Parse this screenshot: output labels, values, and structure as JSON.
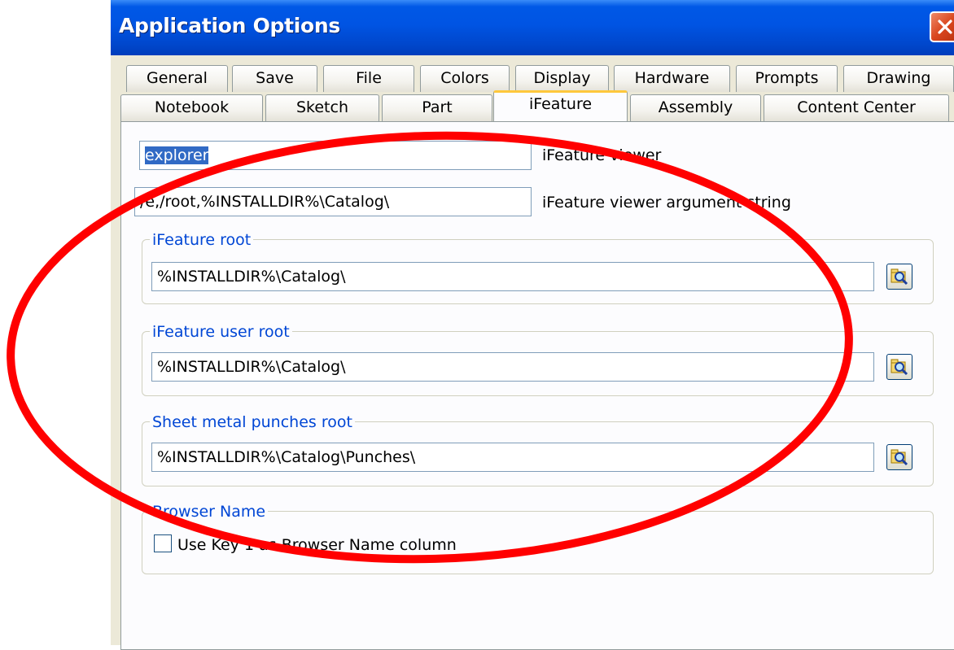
{
  "window": {
    "title": "Application Options"
  },
  "tabs_row1": [
    "General",
    "Save",
    "File",
    "Colors",
    "Display",
    "Hardware",
    "Prompts",
    "Drawing"
  ],
  "tabs_row2": [
    "Notebook",
    "Sketch",
    "Part",
    "iFeature",
    "Assembly",
    "Content Center"
  ],
  "active_tab": "iFeature",
  "viewer": {
    "value": "explorer",
    "label": "iFeature viewer"
  },
  "viewer_args": {
    "value": "/e,/root,%INSTALLDIR%\\Catalog\\",
    "label": "iFeature viewer argument string"
  },
  "ifeature_root": {
    "legend": "iFeature root",
    "value": "%INSTALLDIR%\\Catalog\\"
  },
  "ifeature_user_root": {
    "legend": "iFeature user root",
    "value": "%INSTALLDIR%\\Catalog\\"
  },
  "punches_root": {
    "legend": "Sheet metal punches root",
    "value": "%INSTALLDIR%\\Catalog\\Punches\\"
  },
  "browser_name": {
    "legend": "Browser Name",
    "checkbox_label": "Use Key 1 as Browser Name column",
    "checked": false
  },
  "icons": {
    "close": "close-icon",
    "browse": "folder-search-icon"
  },
  "colors": {
    "title_bar": "#0054e3",
    "annotation": "#ff0000",
    "active_tab_accent": "#ffc83c",
    "group_legend": "#0046d5"
  }
}
